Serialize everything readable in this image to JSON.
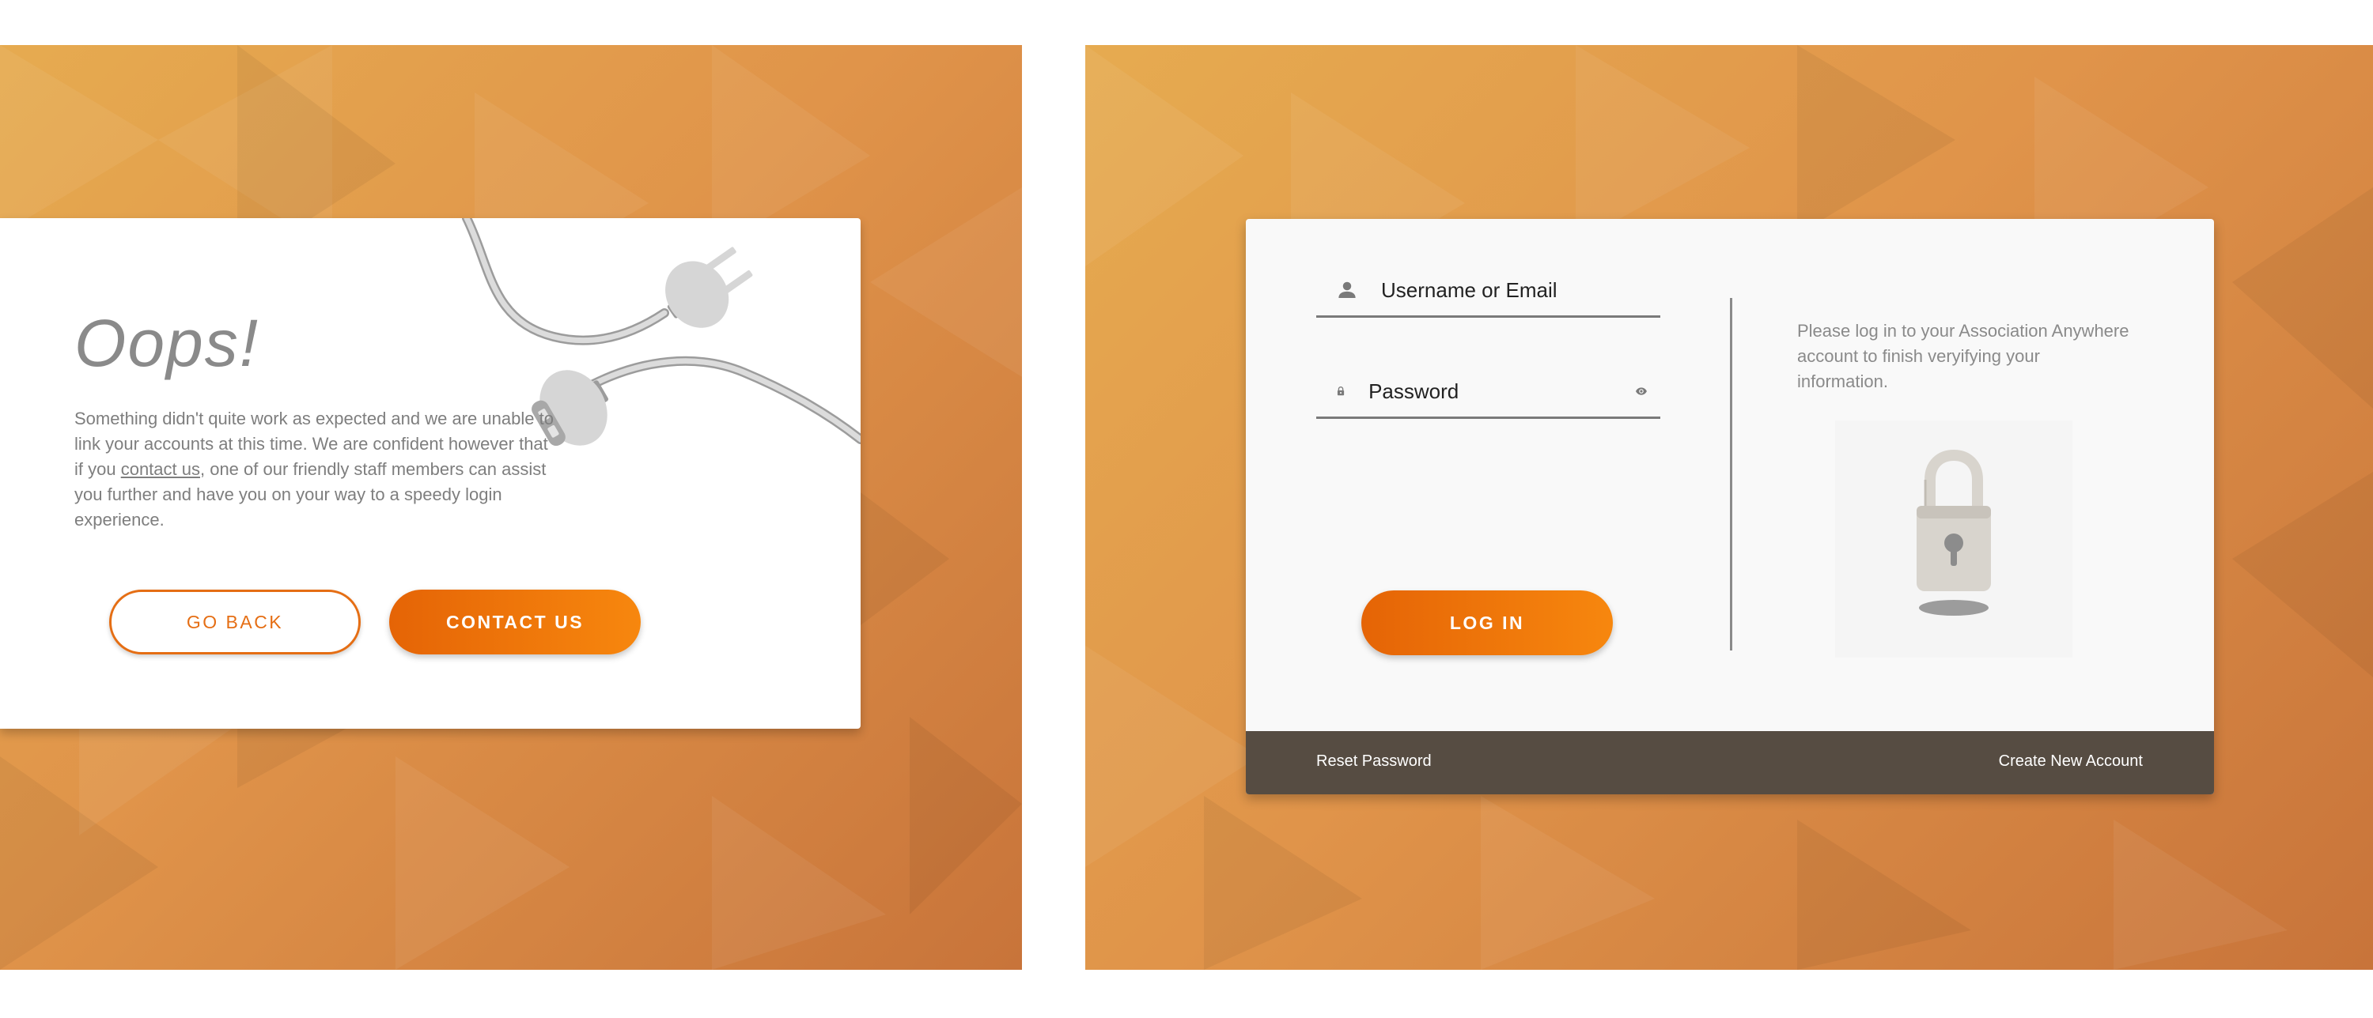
{
  "error_card": {
    "title": "Oops!",
    "message_before": "Something didn't quite work as expected and we are unable to link your accounts at this time. We are confident however that if you ",
    "contact_link": "contact us",
    "message_after": ", one of our friendly staff members can assist you further and have you on your way to a speedy login experience.",
    "go_back_label": "GO BACK",
    "contact_us_label": "CONTACT US",
    "illustration": "unplugged-cables-illustration"
  },
  "login_card": {
    "username_placeholder": "Username or Email",
    "password_placeholder": "Password",
    "login_label": "LOG IN",
    "info_text": "Please log in to your Association Anywhere account to finish veryifying your information.",
    "illustration": "padlock-illustration",
    "footer": {
      "reset_label": "Reset Password",
      "create_label": "Create New Account"
    },
    "icons": {
      "username": "person-icon",
      "password": "lock-icon",
      "visibility": "eye-icon"
    }
  },
  "colors": {
    "accent": "#e56e14",
    "accent_light": "#f7870e",
    "background_warm": "#e0944a",
    "footer": "#564c42",
    "text_muted": "#7e7e7e"
  }
}
